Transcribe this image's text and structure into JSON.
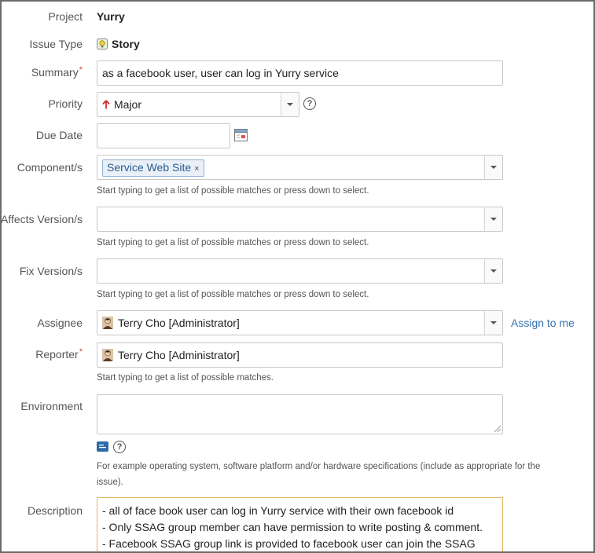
{
  "fields": {
    "project": {
      "label": "Project",
      "value": "Yurry"
    },
    "issue_type": {
      "label": "Issue Type",
      "value": "Story"
    },
    "summary": {
      "label": "Summary",
      "required_mark": "*",
      "value": "as a facebook user, user can log in Yurry service"
    },
    "priority": {
      "label": "Priority",
      "value": "Major",
      "help": "?"
    },
    "due_date": {
      "label": "Due Date",
      "value": ""
    },
    "components": {
      "label": "Component/s",
      "chips": [
        "Service Web Site"
      ],
      "chip_remove": "×",
      "hint": "Start typing to get a list of possible matches or press down to select."
    },
    "affects_versions": {
      "label": "Affects Version/s",
      "hint": "Start typing to get a list of possible matches or press down to select."
    },
    "fix_versions": {
      "label": "Fix Version/s",
      "hint": "Start typing to get a list of possible matches or press down to select."
    },
    "assignee": {
      "label": "Assignee",
      "value": "Terry Cho [Administrator]",
      "assign_link": "Assign to me"
    },
    "reporter": {
      "label": "Reporter",
      "required_mark": "*",
      "value": "Terry Cho [Administrator]",
      "hint": "Start typing to get a list of possible matches."
    },
    "environment": {
      "label": "Environment",
      "help": "?",
      "hint_line1": "For example operating system, software platform and/or hardware specifications (include as appropriate for the",
      "hint_line2": "issue)."
    },
    "description": {
      "label": "Description",
      "lines": [
        "- all of face book user can log in Yurry service with their own facebook id",
        "- Only SSAG group member can have permission to write posting & comment.",
        "- Facebook SSAG group link is provided to facebook user can join the SSAG"
      ]
    }
  },
  "colors": {
    "link": "#3572b0",
    "required": "#d04437",
    "priority_arrow": "#cc2b2b",
    "chip_border": "#8fb2d6",
    "description_border": "#e3b65e"
  },
  "icons": {
    "issue_type": "story-lightbulb-icon",
    "priority": "arrow-up-icon",
    "due_date": "calendar-icon",
    "user": "user-avatar-icon",
    "wiki": "wiki-renderer-icon",
    "help": "help-circle-icon"
  }
}
